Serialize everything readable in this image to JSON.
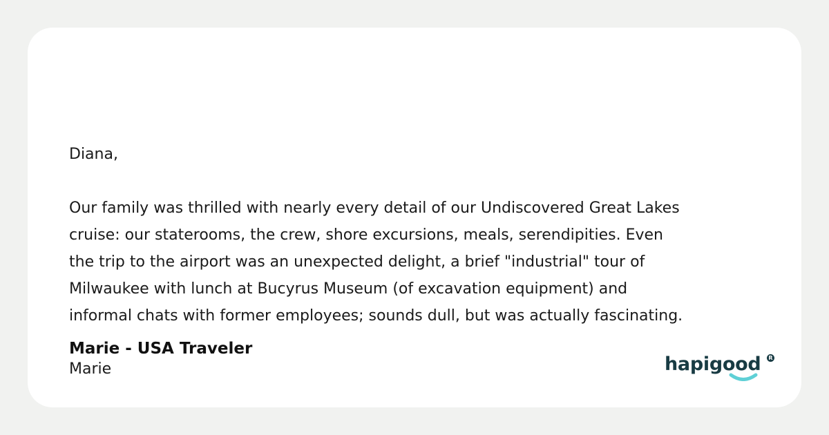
{
  "testimonial": {
    "greeting": "Diana,",
    "message_lines": [
      "Our family was thrilled with nearly every detail of our Undiscovered Great Lakes",
      "cruise: our staterooms, the crew, shore excursions, meals, serendipities. Even",
      "the trip to the airport was an unexpected delight, a brief \"industrial\" tour of",
      "Milwaukee with lunch at Bucyrus Museum (of excavation equipment) and",
      "informal chats with former employees; sounds dull, but was actually fascinating."
    ],
    "author_title": "Marie - USA Traveler",
    "author_name": "Marie"
  },
  "brand": {
    "name": "hapigood",
    "registered_mark": "R",
    "text_color": "#183b43",
    "smile_color": "#5fd0d6"
  },
  "colors": {
    "page_background": "#f1f2f0",
    "card_background": "#ffffff",
    "body_text": "#1a1a1a"
  }
}
